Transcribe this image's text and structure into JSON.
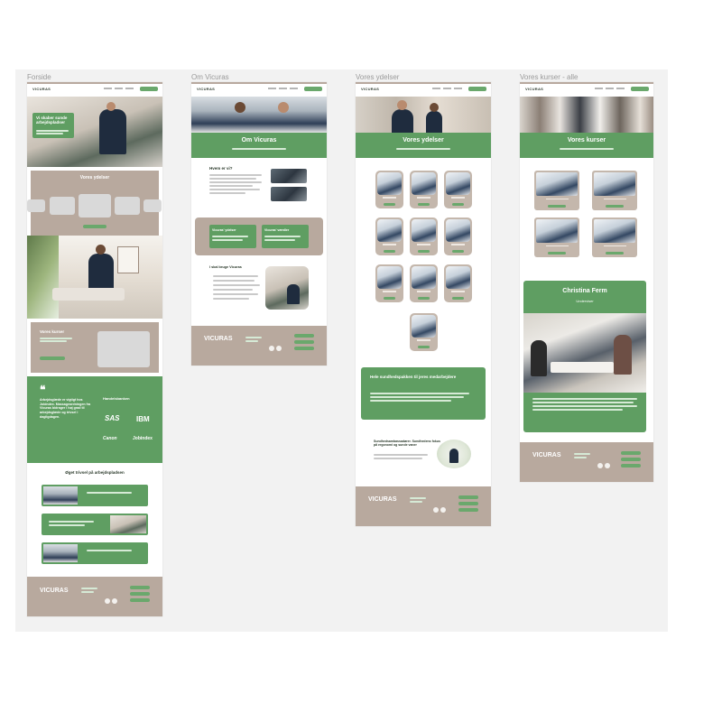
{
  "frames": [
    {
      "label": "Forside",
      "logo": "VICURAS",
      "hero_title": "Vi skaber sunde arbejdspladser",
      "services_title": "Vores ydelser",
      "courses_title": "Vores kurser",
      "quote_mark": "❝",
      "testimonial": "Arbejdsglæde er vigtigt hos Jobindex. Massageordningen fra Vicuras bidrager i høj grad til arbejdsglæde og trivsel i dagligdagen.",
      "client_logos": [
        "Handelsbanken",
        "SAS",
        "IBM",
        "Canon",
        "Jobindex"
      ],
      "wellbeing_title": "Øget trivsel på arbejdspladsen",
      "footer_logo": "VICURAS"
    },
    {
      "label": "Om Vicuras",
      "logo": "VICURAS",
      "hero_title": "Om Vicuras",
      "section1_title": "Hvem er vi?",
      "card1_label": "Vicuras' ydelser",
      "card2_label": "Vicuras' værdier",
      "section2_title": "I skal bruge Vicuras",
      "footer_logo": "VICURAS"
    },
    {
      "label": "Vores ydelser",
      "logo": "VICURAS",
      "hero_title": "Vores ydelser",
      "cta_title": "Hele sundhedspakken til jeres medarbejdere",
      "promo_title": "Sundhedsambassadører. Sundhedens fokus på ergonomi og sunde vaner",
      "footer_logo": "VICURAS"
    },
    {
      "label": "Vores kurser - alle",
      "logo": "VICURAS",
      "hero_title": "Vores kurser",
      "instructor_name": "Christina Ferm",
      "instructor_role": "Underviser",
      "footer_logo": "VICURAS"
    }
  ]
}
